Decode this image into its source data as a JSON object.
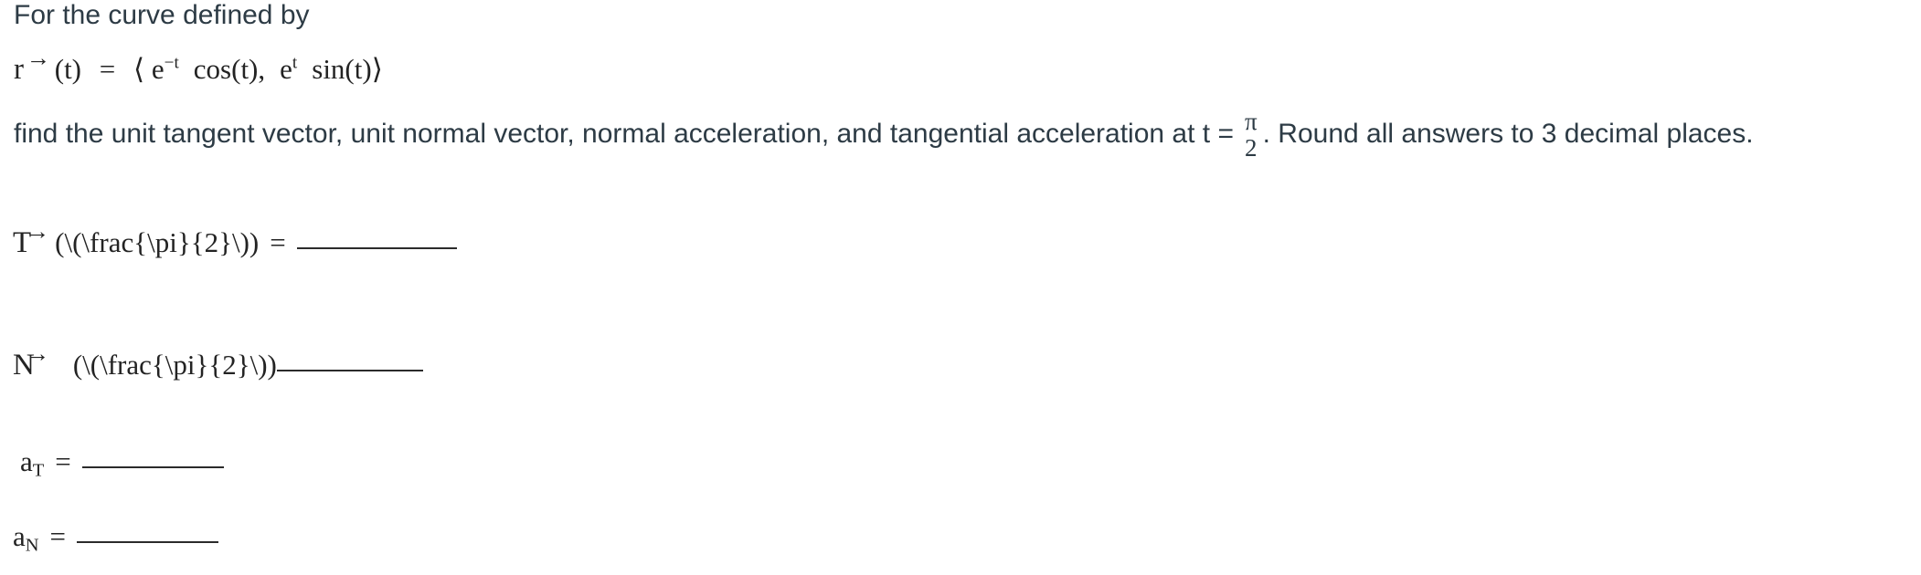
{
  "colors": {
    "body_text": "#2d3b45",
    "math_text": "#232323",
    "background": "#ffffff",
    "rule": "#2b2b2b"
  },
  "problem": {
    "intro": "For the curve defined by",
    "curve": {
      "vector_letter": "r",
      "arrow_glyph": "→",
      "argument": "(t)",
      "equals": "=",
      "open_angle": "⟨",
      "term1_base": "e",
      "term1_exponent": "−t",
      "term1_factor": "cos(t)",
      "comma": ",",
      "term2_base": "e",
      "term2_exponent": "t",
      "term2_factor": "sin(t)",
      "close_angle": "⟩"
    },
    "instruction_part1": "find the unit tangent vector, unit normal vector, normal acceleration, and tangential acceleration at t =",
    "t_value": {
      "numerator": "π",
      "denominator": "2"
    },
    "instruction_part2": ". Round all answers to 3 decimal places."
  },
  "answers": [
    {
      "id": "unit-tangent",
      "vector_letter": "T",
      "arrow_glyph": "→",
      "latex_source": "(\\(\\frac{\\pi}{2}\\))",
      "equals": "=",
      "has_equals": true,
      "blank": "______________"
    },
    {
      "id": "unit-normal",
      "vector_letter": "N",
      "arrow_glyph": "→",
      "latex_source": "(\\(\\frac{\\pi}{2}\\))",
      "equals": "",
      "has_equals": false,
      "blank": "______________"
    },
    {
      "id": "tangential-acceleration",
      "symbol_base": "a",
      "symbol_sub": "T",
      "equals": "=",
      "blank": "______________"
    },
    {
      "id": "normal-acceleration",
      "symbol_base": "a",
      "symbol_sub": "N",
      "equals": "=",
      "blank": "______________"
    }
  ]
}
